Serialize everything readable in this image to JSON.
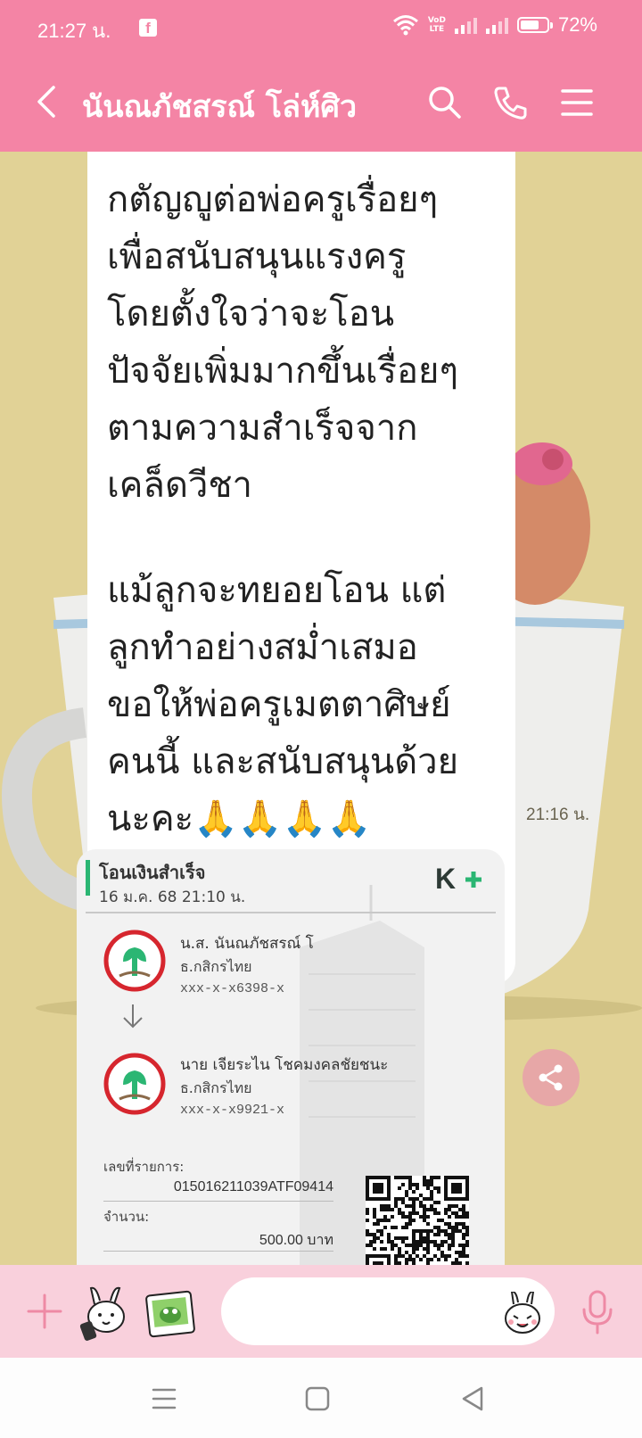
{
  "status_bar": {
    "time": "21:27 น.",
    "notification_app": "f",
    "network_label_top": "VoD",
    "network_label_bottom": "LTE",
    "battery_percent": "72%",
    "battery_level": 0.72
  },
  "header": {
    "title": "นันณภัชสรณ์ โล่ห์ศิว",
    "icons": [
      "back-arrow-icon",
      "search-icon",
      "phone-icon",
      "menu-icon"
    ]
  },
  "message": {
    "lines": [
      "กตัญญูต่อพ่อครูเรื่อยๆ",
      "เพื่อสนับสนุนแรงครู",
      "โดยตั้งใจว่าจะโอน",
      "ปัจจัยเพิ่มมากขึ้นเรื่อยๆ",
      "ตามความสำเร็จจาก",
      "เคล็ดวีชา",
      "",
      "แม้ลูกจะทยอยโอน แต่",
      "ลูกทำอย่างสม่ำเสมอ",
      "ขอให้พ่อครูเมตตาศิษย์",
      "คนนี้ และสนับสนุนด้วย",
      "นะคะ🙏🙏🙏🙏"
    ],
    "time": "21:16 น."
  },
  "slip": {
    "title": "โอนเงินสำเร็จ",
    "date": "16 ม.ค. 68  21:10 น.",
    "brand": "K+",
    "from_name": "น.ส. นันณภัชสรณ์ โ",
    "from_bank": "ธ.กสิกรไทย",
    "from_account": "xxx-x-x6398-x",
    "to_name": "นาย เจียระไน โชคมงคลชัยชนะ",
    "to_bank": "ธ.กสิกรไทย",
    "to_account": "xxx-x-x9921-x",
    "ref_label": "เลขที่รายการ:",
    "ref_value": "015016211039ATF09414",
    "amount_label": "จำนวน:",
    "amount_value": "500.00 บาท"
  },
  "input_bar": {
    "placeholder": "",
    "icons": [
      "plus-icon",
      "sticker-icon",
      "photo-icon",
      "emoji-icon",
      "microphone-icon"
    ]
  },
  "nav_bar": {
    "icons": [
      "recents-icon",
      "home-icon",
      "back-icon"
    ]
  },
  "colors": {
    "header": "#f484a5",
    "chat_background": "#e1d296",
    "input_bar": "#f9d0dc",
    "kbank_green": "#2bb673",
    "kbank_red": "#d6262e"
  }
}
